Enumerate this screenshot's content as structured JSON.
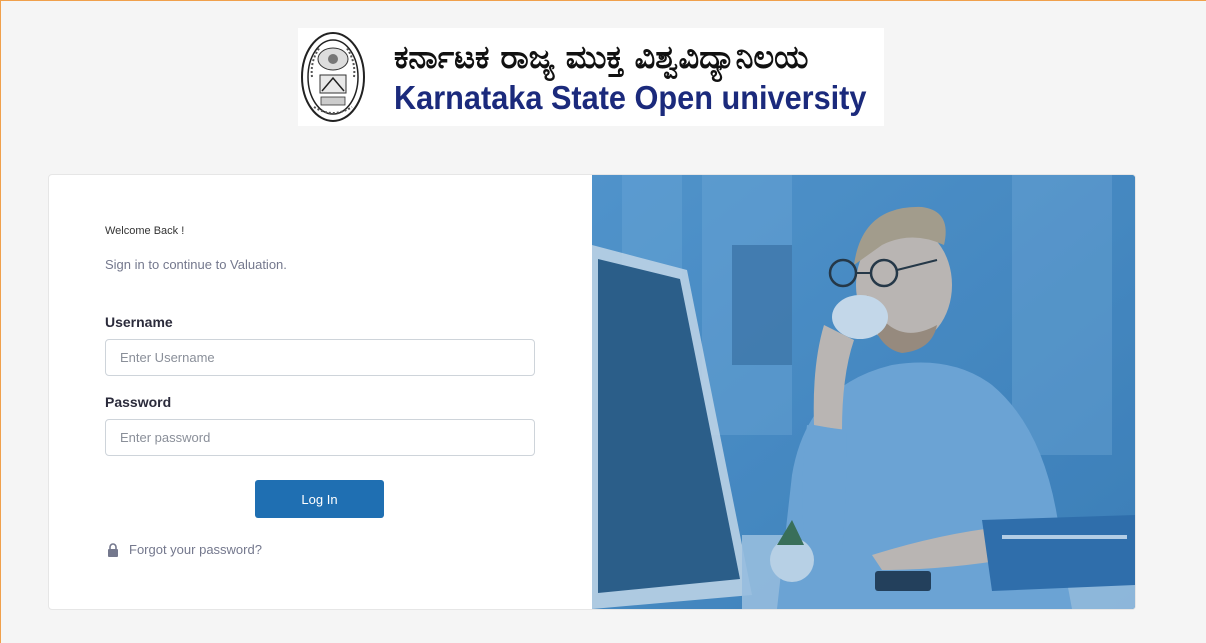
{
  "header": {
    "kannada_title": "ಕರ್ನಾಟಕ ರಾಜ್ಯ ಮುಕ್ತ ವಿಶ್ವವಿದ್ಯಾನಿಲಯ",
    "english_title": "Karnataka State Open university",
    "logo_icon": "university-seal-icon"
  },
  "login": {
    "welcome": "Welcome Back !",
    "subtitle": "Sign in to continue to Valuation.",
    "username_label": "Username",
    "username_placeholder": "Enter Username",
    "username_value": "",
    "password_label": "Password",
    "password_placeholder": "Enter password",
    "password_value": "",
    "login_button": "Log In",
    "forgot_link": "Forgot your password?",
    "forgot_icon": "lock-icon"
  },
  "colors": {
    "accent": "#1f6fb2",
    "title_blue": "#1b2a7c",
    "page_border": "#f0a04b",
    "image_tint": "#4f8fc4"
  }
}
